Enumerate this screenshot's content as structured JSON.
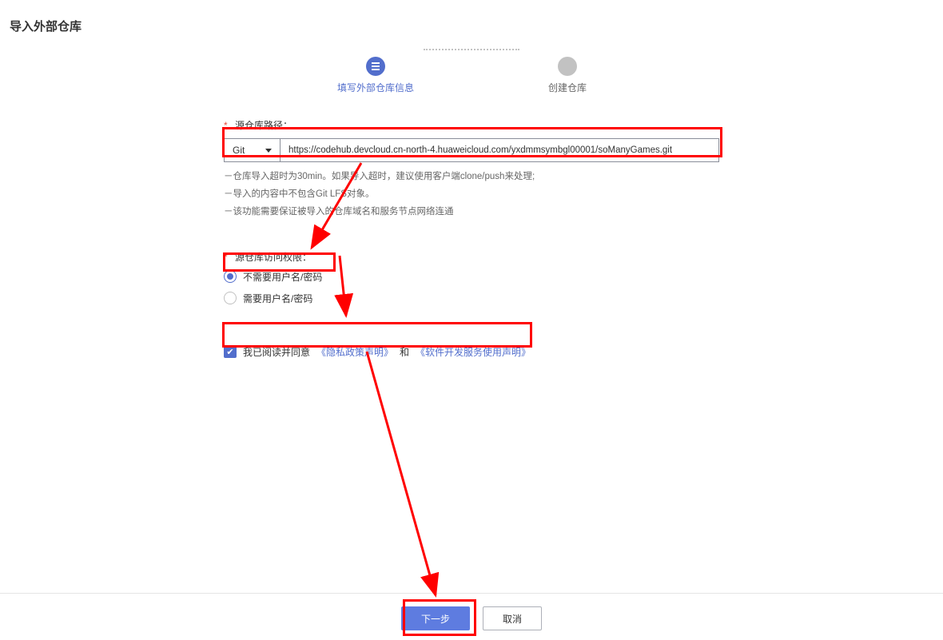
{
  "page_title": "导入外部仓库",
  "wizard": {
    "step1": "填写外部仓库信息",
    "step2": "创建仓库"
  },
  "repo_path": {
    "label": "源仓库路径：",
    "protocol": "Git",
    "value": "https://codehub.devcloud.cn-north-4.huaweicloud.com/yxdmmsymbgl00001/soManyGames.git"
  },
  "hints": {
    "h1": "仓库导入超时为30min。如果导入超时，建议使用客户端clone/push来处理;",
    "h2": "导入的内容中不包含Git LFS对象。",
    "h3": "该功能需要保证被导入的仓库域名和服务节点网络连通"
  },
  "access": {
    "label": "源仓库访问权限：",
    "opt_no_auth": "不需要用户名/密码",
    "opt_auth": "需要用户名/密码"
  },
  "agreement": {
    "prefix": "我已阅读并同意",
    "privacy": "《隐私政策声明》",
    "and": "和",
    "service": "《软件开发服务使用声明》"
  },
  "buttons": {
    "next": "下一步",
    "cancel": "取消"
  }
}
